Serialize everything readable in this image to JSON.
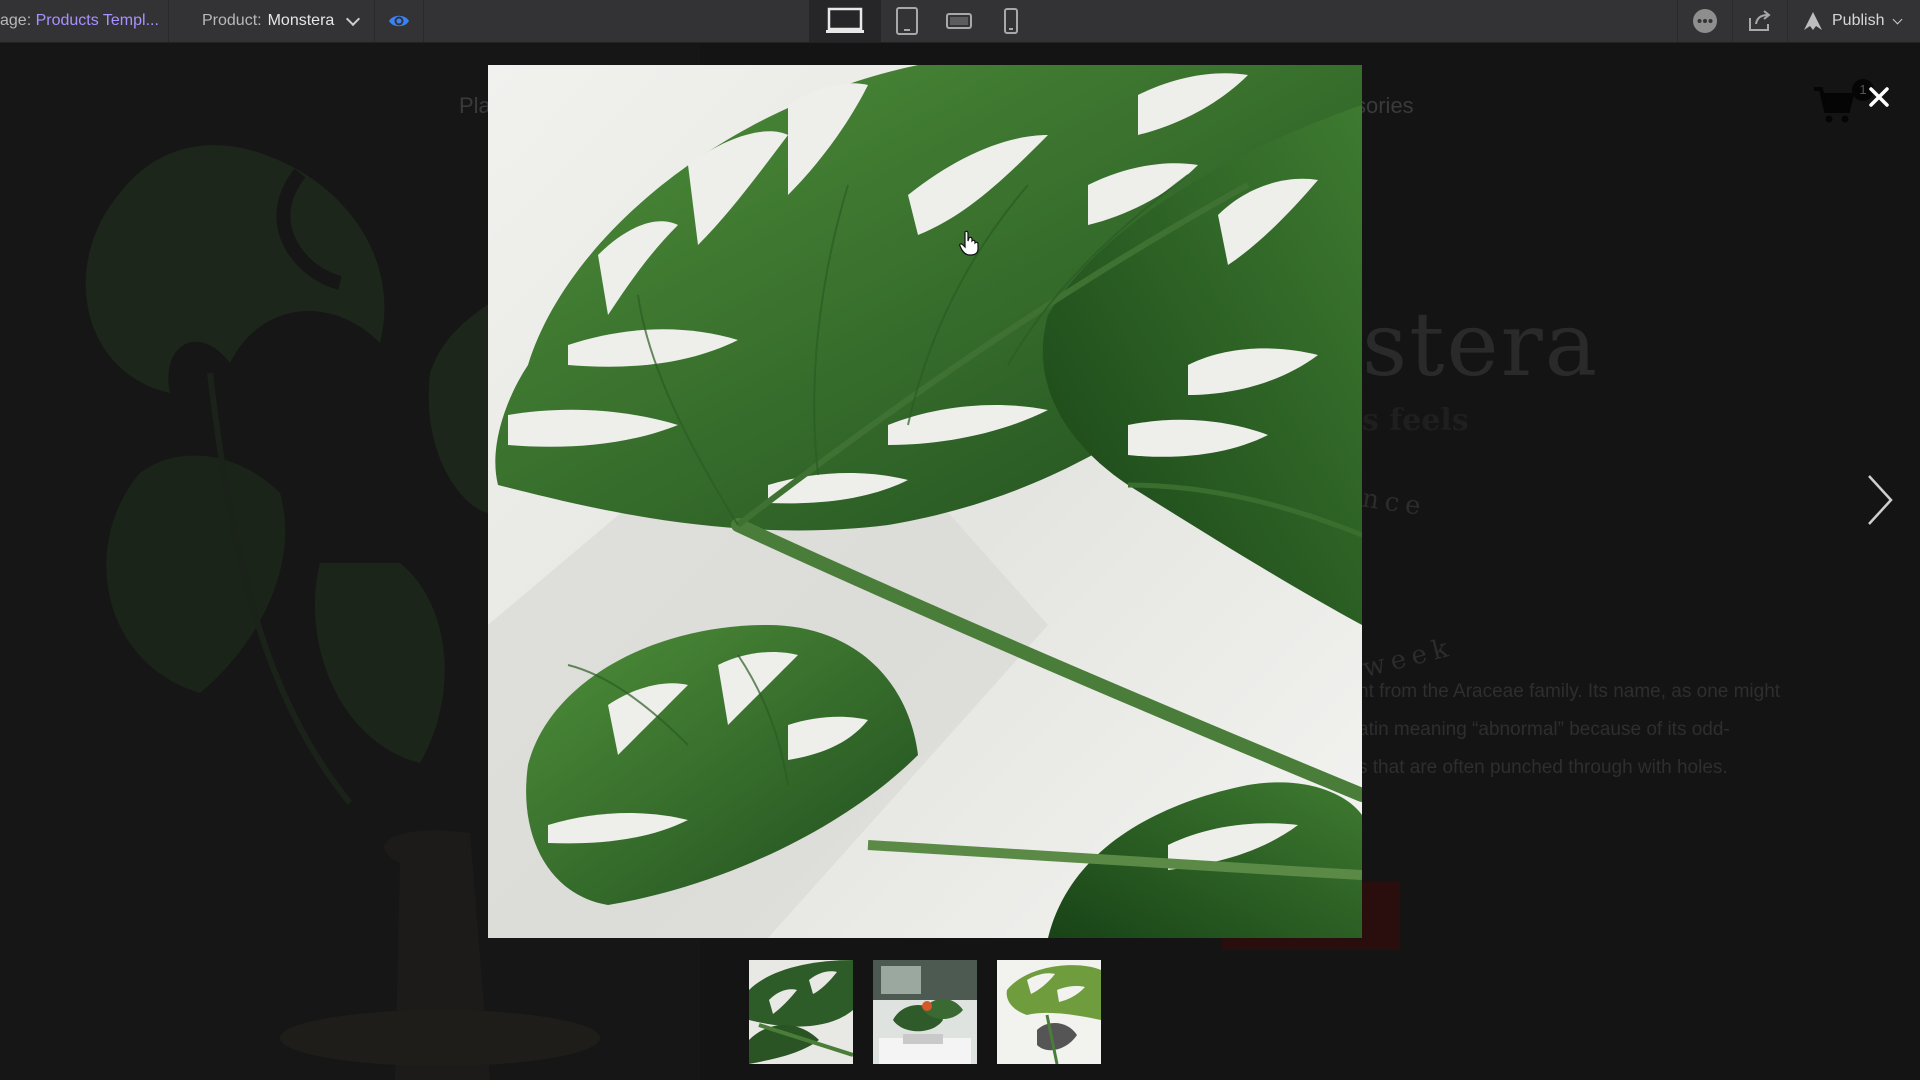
{
  "toolbar": {
    "page_prefix": "age:",
    "page_value": "Products Templ...",
    "product_label": "Product:",
    "product_value": "Monstera",
    "publish_label": "Publish",
    "device_modes": [
      "desktop",
      "tablet",
      "tablet-landscape",
      "mobile"
    ],
    "active_device": "desktop"
  },
  "site": {
    "nav_left_fragment": "Pla",
    "nav_right_fragment": "sories",
    "cart_count": "1",
    "title_fragment": "stera",
    "subtitle_fragment": "s feels",
    "care_top_fragment": "nce",
    "care_bottom_fragment": "week",
    "description_lines": [
      "nt from the Araceae family. Its name, as one might",
      "atin meaning “abnormal” because of its odd-",
      "s that are often punched through with holes."
    ]
  },
  "lightbox": {
    "thumbnails": [
      {
        "icon": "monstera-leaves-thumbnail"
      },
      {
        "icon": "plant-shelf-thumbnail"
      },
      {
        "icon": "monstera-leaf-light-thumbnail"
      }
    ]
  },
  "colors": {
    "toolbar_bg": "#333336",
    "accent_purple": "#a991ff",
    "eye_blue": "#3b82f6",
    "overlay_bg": "#141414",
    "leaf_green": "#2f6b2a"
  }
}
